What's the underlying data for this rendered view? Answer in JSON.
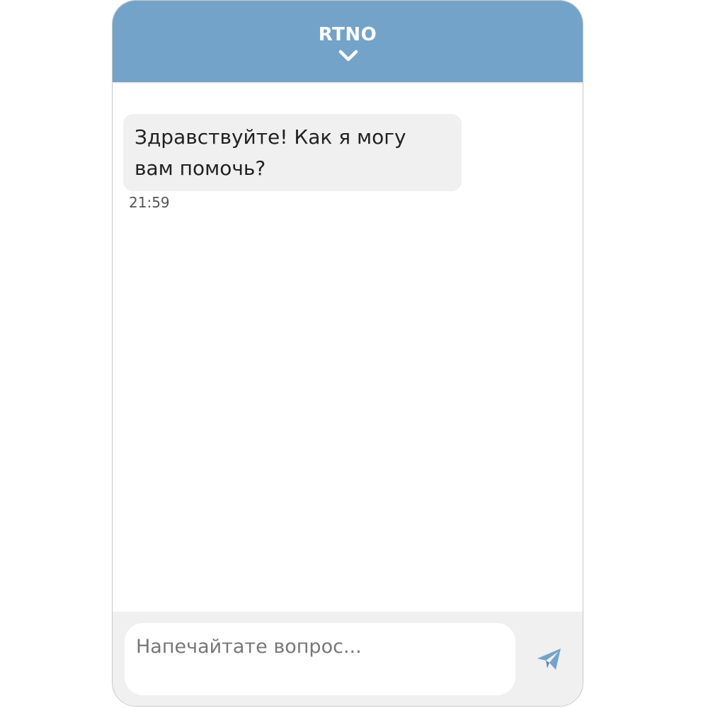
{
  "header": {
    "brand": "RTNO",
    "collapse_icon": "chevron-down-icon"
  },
  "messages": [
    {
      "sender": "bot",
      "text": "Здравствуйте! Как я могу вам помочь?",
      "time": "21:59"
    }
  ],
  "composer": {
    "placeholder": "Напечайтате вопрос...",
    "value": "",
    "send_icon": "send-plane-icon"
  },
  "colors": {
    "header_bg": "#74a3c9",
    "accent": "#74a3c9",
    "bubble_bg": "#f0f0f0",
    "footer_bg": "#f0f0f0"
  }
}
